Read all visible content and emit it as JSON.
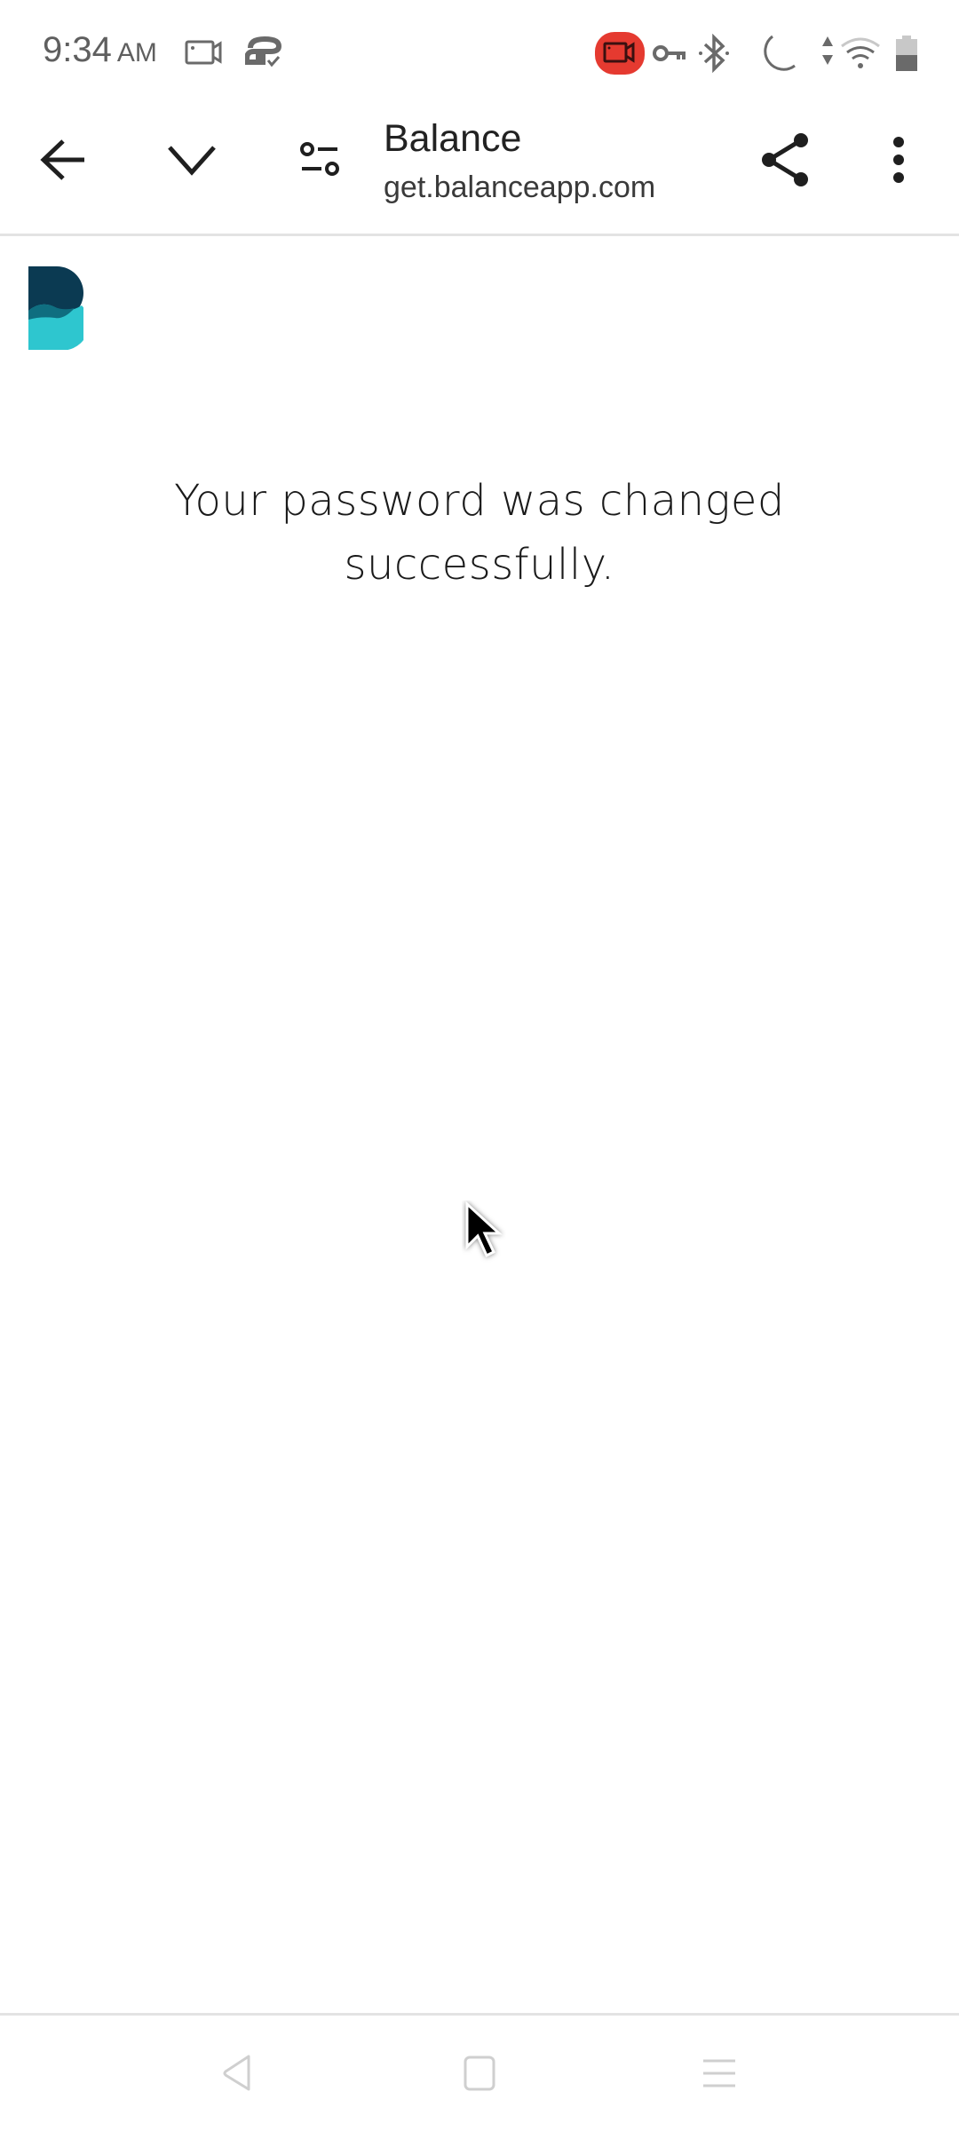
{
  "status_bar": {
    "time": "9:34",
    "ampm": "AM",
    "left_icons": [
      "screen-record-icon",
      "vpn-sync-icon"
    ],
    "right_icons": [
      "recording-indicator-icon",
      "vpn-key-icon",
      "bluetooth-icon",
      "do-not-disturb-moon-icon",
      "data-arrows-icon",
      "wifi-icon",
      "battery-icon"
    ],
    "recording_color": "#e53a30"
  },
  "toolbar": {
    "back_icon": "back-arrow-icon",
    "minimize_icon": "chevron-down-icon",
    "site_settings_icon": "tune-icon",
    "title": "Balance",
    "url": "get.balanceapp.com",
    "share_icon": "share-icon",
    "menu_icon": "more-vert-icon"
  },
  "content": {
    "logo": "balance-logo",
    "logo_colors": {
      "dark": "#0b3a52",
      "mid": "#0f6e80",
      "light": "#2ec6cf"
    },
    "message": "Your password was changed successfully."
  },
  "nav_bar": {
    "back": "nav-back-icon",
    "home": "nav-home-icon",
    "recents": "nav-recents-icon"
  }
}
